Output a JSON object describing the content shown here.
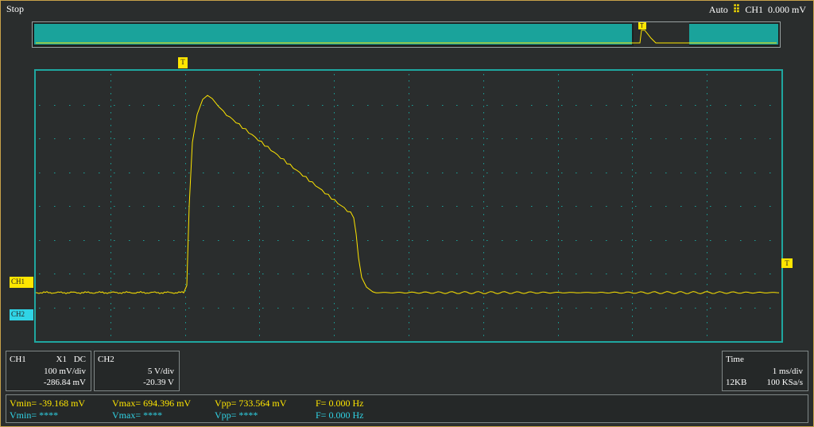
{
  "status": {
    "state": "Stop",
    "trigger_mode": "Auto",
    "trigger_source": "CH1",
    "trigger_level": "0.000 mV"
  },
  "markers": {
    "trigger": "T",
    "ch1": "CH1",
    "ch2": "CH2",
    "level": "T"
  },
  "channels": {
    "ch1": {
      "label": "CH1",
      "probe": "X1",
      "coupling": "DC",
      "scale": "100 mV/div",
      "offset": "-286.84 mV",
      "color": "#ffe600"
    },
    "ch2": {
      "label": "CH2",
      "scale": "5 V/div",
      "offset": "-20.39 V",
      "color": "#30d4e6"
    }
  },
  "timebase": {
    "label": "Time",
    "scale": "1 ms/div",
    "memory": "12KB",
    "sample_rate": "100 KSa/s"
  },
  "measurements": {
    "ch1": {
      "vmin": "Vmin= -39.168 mV",
      "vmax": "Vmax= 694.396 mV",
      "vpp": "Vpp= 733.564 mV",
      "freq": "F= 0.000 Hz"
    },
    "ch2": {
      "vmin": "Vmin= ****",
      "vmax": "Vmax= ****",
      "vpp": "Vpp= ****",
      "freq": "F= 0.000 Hz"
    }
  },
  "colors": {
    "grid_border": "#1fa7a0",
    "grid_dots": "#1aa39b",
    "overview_fill": "#1aa39b",
    "trace_ch1": "#ffe600"
  }
}
